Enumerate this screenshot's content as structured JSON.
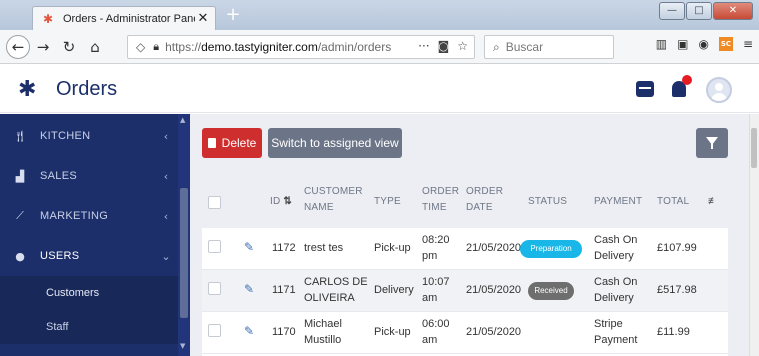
{
  "browser": {
    "tab_title": "Orders - Administrator Panel - |",
    "tab_close": "✕",
    "new_tab": "+",
    "url_domain": "demo.tastyigniter.com",
    "url_prefix": "https://",
    "url_path": "/admin/orders",
    "search_placeholder": "Buscar",
    "ext_label": "SC"
  },
  "app": {
    "title": "Orders"
  },
  "sidebar": {
    "items": [
      {
        "label": "KITCHEN",
        "chevron": "‹"
      },
      {
        "label": "SALES",
        "chevron": "‹"
      },
      {
        "label": "MARKETING",
        "chevron": "‹"
      },
      {
        "label": "USERS",
        "chevron": "⌄"
      }
    ],
    "subitems": [
      {
        "label": "Customers"
      },
      {
        "label": "Staff"
      }
    ]
  },
  "toolbar": {
    "delete_label": "Delete",
    "switch_label": "Switch to assigned view"
  },
  "table": {
    "headers": {
      "id": "ID",
      "customer_name": "CUSTOMER NAME",
      "type": "TYPE",
      "order_time": "ORDER TIME",
      "order_date": "ORDER DATE",
      "status": "STATUS",
      "payment": "PAYMENT",
      "total": "TOTAL"
    },
    "rows": [
      {
        "id": "1172",
        "customer": "trest tes",
        "type": "Pick-up",
        "time": "08:20 pm",
        "date": "21/05/2020",
        "status": "Preparation",
        "status_color": "#18b7e8",
        "payment": "Cash On Delivery",
        "total": "£107.99"
      },
      {
        "id": "1171",
        "customer": "CARLOS DE OLIVEIRA",
        "type": "Delivery",
        "time": "10:07 am",
        "date": "21/05/2020",
        "status": "Received",
        "status_color": "#6e6e6e",
        "payment": "Cash On Delivery",
        "total": "£517.98"
      },
      {
        "id": "1170",
        "customer": "Michael Mustillo",
        "type": "Pick-up",
        "time": "06:00 am",
        "date": "21/05/2020",
        "status": "",
        "payment": "Stripe Payment",
        "total": "£11.99"
      }
    ]
  }
}
